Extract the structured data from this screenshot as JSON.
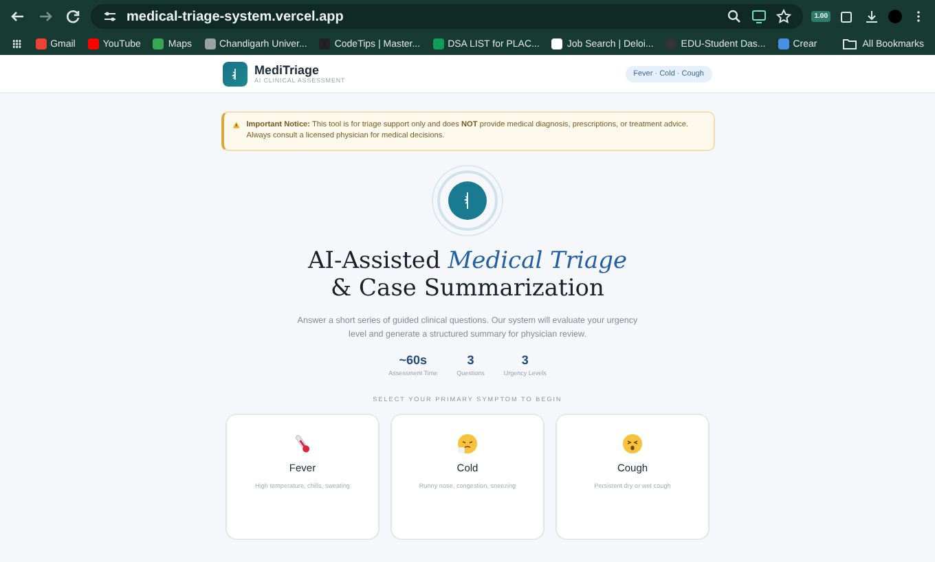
{
  "browser": {
    "url": "medical-triage-system.vercel.app",
    "extension_badge": "1.00",
    "bookmarks": [
      {
        "label": "Gmail",
        "color": "#ea4335"
      },
      {
        "label": "YouTube",
        "color": "#ff0000"
      },
      {
        "label": "Maps",
        "color": "#34a853"
      },
      {
        "label": "Chandigarh Univer...",
        "color": "#9aa0a6"
      },
      {
        "label": "CodeTips | Master...",
        "color": "#222222"
      },
      {
        "label": "DSA LIST for PLAC...",
        "color": "#0f9d58"
      },
      {
        "label": "Job Search | Deloi...",
        "color": "#ffffff"
      },
      {
        "label": "EDU-Student Das...",
        "color": "#333333"
      },
      {
        "label": "Crear",
        "color": "#4a90e2"
      }
    ],
    "all_bookmarks": "All Bookmarks"
  },
  "header": {
    "brand": "MediTriage",
    "tagline": "AI CLINICAL ASSESSMENT",
    "badge": "Fever · Cold · Cough"
  },
  "notice": {
    "text": "**Important Notice:** This tool is for triage support only and does **NOT** provide medical diagnosis, prescriptions, or treatment advice. Always consult a licensed physician for medical decisions."
  },
  "hero": {
    "title_plain": "AI-Assisted ",
    "title_accent": "Medical Triage",
    "title_line2": "& Case Summarization",
    "description": "Answer a short series of guided clinical questions. Our system will evaluate your urgency level and generate a structured summary for physician review."
  },
  "stats": [
    {
      "value": "~60s",
      "label": "Assessment Time"
    },
    {
      "value": "3",
      "label": "Questions"
    },
    {
      "value": "3",
      "label": "Urgency Levels"
    }
  ],
  "symptom_prompt": "SELECT YOUR PRIMARY SYMPTOM TO BEGIN",
  "symptoms": [
    {
      "kind": "thermometer",
      "name": "Fever",
      "description": "High temperature, chills, sweating"
    },
    {
      "kind": "sneeze",
      "name": "Cold",
      "description": "Runny nose, congestion, sneezing"
    },
    {
      "kind": "tired",
      "name": "Cough",
      "description": "Persistent dry or wet cough"
    }
  ]
}
